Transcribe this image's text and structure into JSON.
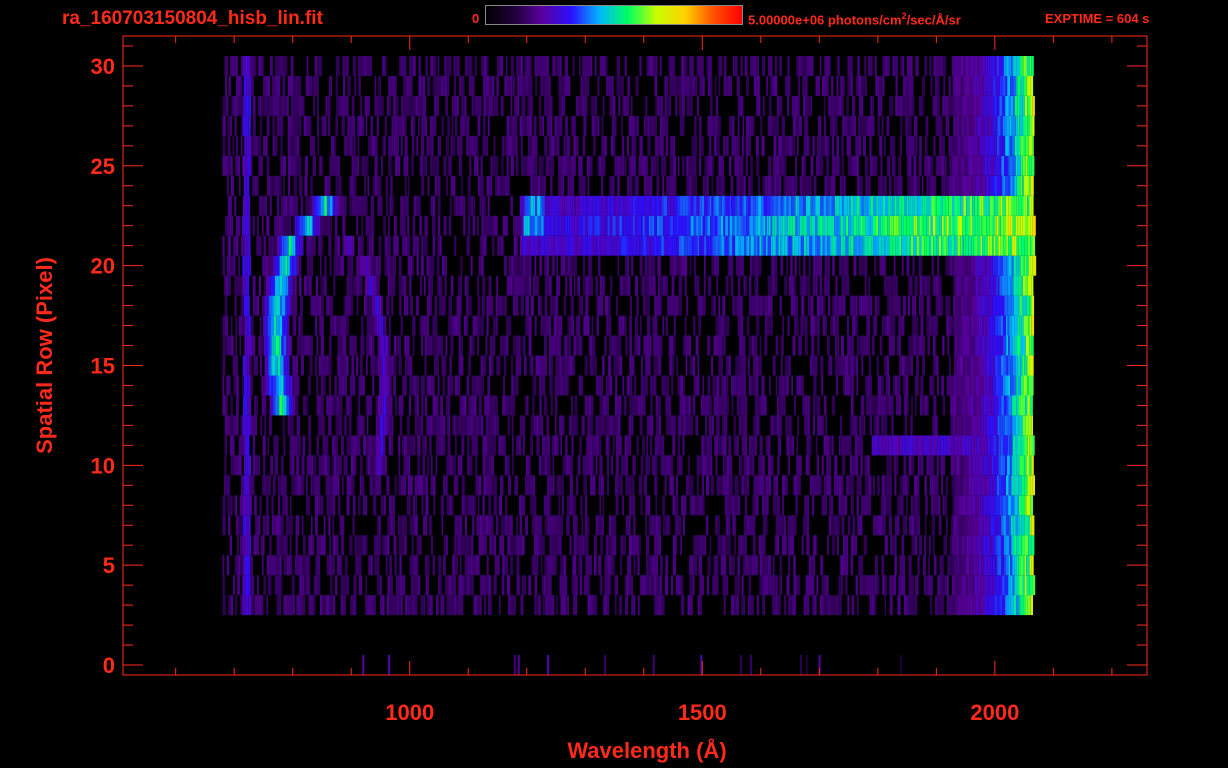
{
  "header": {
    "file_title": "ra_160703150804_hisb_lin.fit",
    "colorbar_min": "0",
    "colorbar_max_prefix": "5.00000e+06 photons/cm",
    "colorbar_max_exp": "2",
    "colorbar_max_suffix": "/sec/Å/sr",
    "exptime": "EXPTIME = 604 s"
  },
  "colors": {
    "axis": "#ff2a1a",
    "background": "#000000",
    "colormap": [
      "#000000",
      "#1f003a",
      "#5a00a0",
      "#2a10ff",
      "#00b8ff",
      "#00ff60",
      "#c8ff00",
      "#ffd200",
      "#ff5000",
      "#ff0000"
    ]
  },
  "chart_data": {
    "type": "heatmap",
    "title": "ra_160703150804_hisb_lin.fit",
    "xlabel": "Wavelength (Å)",
    "ylabel": "Spatial Row (Pixel)",
    "xlim": [
      510,
      2260
    ],
    "ylim": [
      -0.5,
      31.5
    ],
    "x_ticks": [
      1000,
      1500,
      2000
    ],
    "y_ticks": [
      0,
      5,
      10,
      15,
      20,
      25,
      30
    ],
    "colorbar": {
      "min": 0,
      "max": 5000000,
      "units": "photons/cm²/sec/Å/sr"
    },
    "exptime_s": 604,
    "detector": {
      "x_min": 680,
      "x_max": 2065,
      "row_min": 3,
      "row_max": 30
    },
    "features": [
      {
        "name": "arc-outer-branch",
        "points": [
          [
            780,
            13
          ],
          [
            773,
            15
          ],
          [
            772,
            17
          ],
          [
            779,
            19
          ],
          [
            796,
            21
          ],
          [
            825,
            22
          ],
          [
            856,
            23
          ],
          [
            895,
            23.5
          ],
          [
            925,
            23
          ]
        ],
        "intensity": 0.55
      },
      {
        "name": "arc-inner-branch",
        "points": [
          [
            896,
            21
          ],
          [
            925,
            20
          ],
          [
            945,
            18
          ],
          [
            956,
            16
          ],
          [
            957,
            14
          ],
          [
            954,
            12
          ],
          [
            948,
            10
          ]
        ],
        "intensity": 0.32
      },
      {
        "name": "horizontal-band",
        "rows": [
          21,
          22,
          23
        ],
        "x_start": 1190,
        "x_end": 2065,
        "intensity_start": 0.3,
        "intensity_end": 0.72
      },
      {
        "name": "band-knot",
        "x": [
          1195,
          1230
        ],
        "rows": [
          22,
          23
        ],
        "intensity": 0.45
      },
      {
        "name": "faint-row-11",
        "x_start": 1790,
        "x_end": 2000,
        "row": 11,
        "intensity": 0.28
      },
      {
        "name": "edge-column",
        "x_start": 1930,
        "x_end": 2065,
        "intensity_start": 0.2,
        "intensity_end": 0.7
      },
      {
        "name": "sensor-column",
        "x": 722,
        "rows": [
          3,
          30
        ],
        "intensity": 0.3
      }
    ]
  }
}
